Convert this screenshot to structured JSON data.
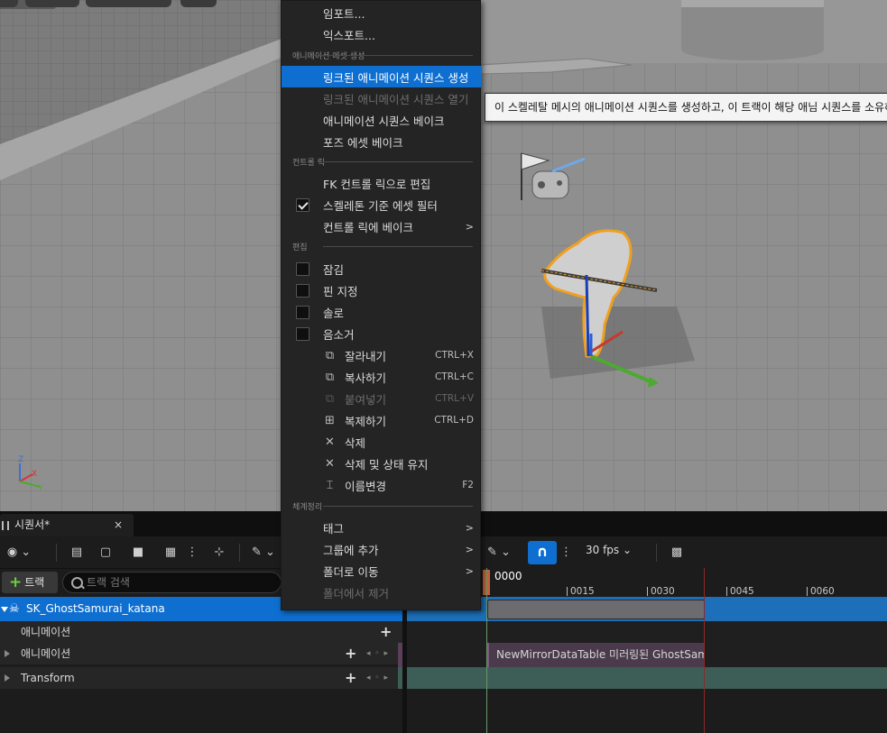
{
  "context_menu": {
    "items_top": [
      {
        "label": "임포트...",
        "disabled": false
      },
      {
        "label": "익스포트...",
        "disabled": false
      }
    ],
    "section_anim_asset": "애니메이션 에셋 생성",
    "anim_items": [
      {
        "label": "링크된 애니메이션 시퀀스 생성",
        "disabled": false,
        "highlighted": true
      },
      {
        "label": "링크된 애니메이션 시퀀스 열기",
        "disabled": true
      },
      {
        "label": "애니메이션 시퀀스 베이크",
        "disabled": false
      },
      {
        "label": "포즈 에셋 베이크",
        "disabled": false
      }
    ],
    "section_control_rig": "컨트롤 릭",
    "rig_items": [
      {
        "label": "FK 컨트롤 릭으로 편집"
      },
      {
        "label": "스켈레톤 기준 에셋 필터",
        "checked": true
      },
      {
        "label": "컨트롤 릭에 베이크",
        "submenu": true
      }
    ],
    "section_edit": "편집",
    "edit_checks": [
      {
        "label": "잠김",
        "checked": false
      },
      {
        "label": "핀 지정",
        "checked": false
      },
      {
        "label": "솔로",
        "checked": false
      },
      {
        "label": "음소거",
        "checked": false
      }
    ],
    "edit_actions": [
      {
        "label": "잘라내기",
        "shortcut": "CTRL+X",
        "icon": "cut-icon",
        "disabled": false
      },
      {
        "label": "복사하기",
        "shortcut": "CTRL+C",
        "icon": "copy-icon",
        "disabled": false
      },
      {
        "label": "붙여넣기",
        "shortcut": "CTRL+V",
        "icon": "paste-icon",
        "disabled": true
      },
      {
        "label": "복제하기",
        "shortcut": "CTRL+D",
        "icon": "duplicate-icon",
        "disabled": false
      },
      {
        "label": "삭제",
        "shortcut": "",
        "icon": "delete-icon",
        "disabled": false
      },
      {
        "label": "삭제 및 상태 유지",
        "shortcut": "",
        "icon": "delete-icon",
        "disabled": false
      },
      {
        "label": "이름변경",
        "shortcut": "F2",
        "icon": "rename-icon",
        "disabled": false
      }
    ],
    "section_organize": "체계정리",
    "organize_items": [
      {
        "label": "태그",
        "submenu": true,
        "disabled": false
      },
      {
        "label": "그룹에 추가",
        "submenu": true,
        "disabled": false
      },
      {
        "label": "폴더로 이동",
        "submenu": true,
        "disabled": false
      },
      {
        "label": "폴더에서 제거",
        "submenu": false,
        "disabled": true
      }
    ]
  },
  "tooltip": {
    "text": "이 스켈레탈 메시의 애니메이션 시퀀스를 생성하고, 이 트랙이 해당 애님 시퀀스를 소유하도"
  },
  "sequencer": {
    "tab_title": "시퀀서*",
    "close_label": "×",
    "add_track_label": "트랙",
    "search_placeholder": "트랙 검색",
    "fps_label": "30 fps",
    "current_time": "0000",
    "ruler_labels": [
      "0015",
      "0030",
      "0045",
      "0060"
    ],
    "tracks": [
      {
        "name": "SK_GhostSamurai_katana",
        "selected": true
      },
      {
        "name": "애니메이션",
        "selected": false
      },
      {
        "name": "애니메이션",
        "selected": false
      },
      {
        "name": "Transform",
        "selected": false
      }
    ],
    "section_label": "NewMirrorDataTable 미러링된 GhostSamurai",
    "keyframe_glyph": "◂ ◦ ▸"
  },
  "colors": {
    "accent": "#0e6fd1",
    "selection_outline": "#f0a020",
    "section_purple": "#4a3a4b",
    "transform_lane": "#3f5f58"
  }
}
